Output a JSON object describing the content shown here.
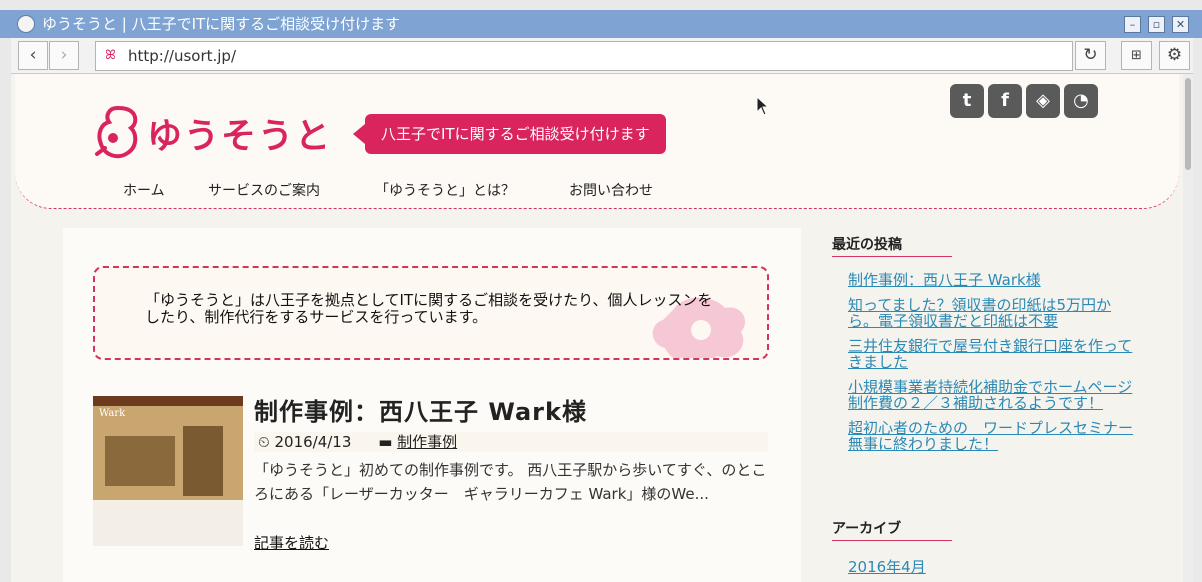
{
  "window": {
    "title": "ゆうそうと | 八王子でITに関するご相談受け付けます"
  },
  "toolbar": {
    "url": "http://usort.jp/"
  },
  "header": {
    "logo_text": "ゆうそうと",
    "tagline": "八王子でITに関するご相談受け付けます",
    "nav": [
      "ホーム",
      "サービスのご案内",
      "「ゆうそうと」とは？",
      "お問い合わせ"
    ],
    "social": [
      "twitter-icon",
      "facebook-icon",
      "feedly-icon",
      "rss-icon"
    ]
  },
  "main": {
    "intro": "「ゆうそうと」は八王子を拠点としてITに関するご相談を受けたり、個人レッスンをしたり、制作代行をするサービスを行っています。",
    "post": {
      "title": "制作事例：西八王子 Wark様",
      "date": "2016/4/13",
      "category": "制作事例",
      "excerpt": "「ゆうそうと」初めての制作事例です。 西八王子駅から歩いてすぐ、のところにある「レーザーカッター　ギャラリーカフェ Wark」様のWe...",
      "read_more": "記事を読む",
      "thumb_label": "Wark"
    }
  },
  "sidebar": {
    "recent_heading": "最近の投稿",
    "recent_posts": [
      "制作事例：西八王子 Wark様",
      "知ってました？領収書の印紙は5万円から。電子領収書だと印紙は不要",
      "三井住友銀行で屋号付き銀行口座を作ってきました",
      "小規模事業者持続化補助金でホームページ制作費の２／３補助されるようです！",
      "超初心者のための　ワードプレスセミナー 無事に終わりました！"
    ],
    "archive_heading": "アーカイブ",
    "archives": [
      "2016年4月"
    ]
  },
  "colors": {
    "accent": "#d9245d",
    "link": "#2a8ab5",
    "titlebar": "#7fa4d3"
  }
}
